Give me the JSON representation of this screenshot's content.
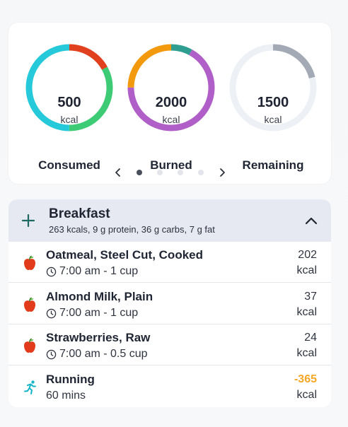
{
  "summary": {
    "rings": [
      {
        "id": "consumed",
        "value": "500",
        "unit": "kcal",
        "label": "Consumed",
        "segments": [
          {
            "color": "#e0401e",
            "fraction": 0.17
          },
          {
            "color": "#3ecb75",
            "fraction": 0.33
          },
          {
            "color": "#25c9d9",
            "fraction": 0.5
          }
        ]
      },
      {
        "id": "burned",
        "value": "2000",
        "unit": "kcal",
        "label": "Burned",
        "segments": [
          {
            "color": "#2e9e90",
            "fraction": 0.08
          },
          {
            "color": "#b05fc8",
            "fraction": 0.67
          },
          {
            "color": "#f2990e",
            "fraction": 0.25
          }
        ]
      },
      {
        "id": "remaining",
        "value": "1500",
        "unit": "kcal",
        "label": "Remaining",
        "segments": [
          {
            "color": "#a3a9b5",
            "fraction": 0.21
          },
          {
            "color": "#edf0f5",
            "fraction": 0.79
          }
        ]
      }
    ],
    "pager": {
      "pages": 4,
      "active_index": 0,
      "prev_icon": "chevron-left-icon",
      "next_icon": "chevron-right-icon"
    }
  },
  "meal": {
    "title": "Breakfast",
    "subtitle": "263 kcals, 9 g protein, 36 g carbs, 7 g fat",
    "add_icon": "plus-icon",
    "collapse_icon": "chevron-up-icon",
    "header_color": "#e6e9f1",
    "entries": [
      {
        "name": "Oatmeal, Steel Cut, Cooked",
        "detail": "7:00 am - 1 cup",
        "kcal": "202",
        "unit": "kcal",
        "icon": "apple-icon"
      },
      {
        "name": "Almond Milk, Plain",
        "detail": "7:00 am - 1 cup",
        "kcal": "37",
        "unit": "kcal",
        "icon": "apple-icon"
      },
      {
        "name": "Strawberries, Raw",
        "detail": "7:00 am - 0.5 cup",
        "kcal": "24",
        "unit": "kcal",
        "icon": "apple-icon"
      },
      {
        "name": "Running",
        "detail": "60 mins",
        "kcal": "-365",
        "unit": "kcal",
        "icon": "running-icon"
      }
    ]
  },
  "colors": {
    "accent_teal": "#14b5c7",
    "apple_red": "#e23b1b",
    "burn_orange": "#f5a623"
  }
}
